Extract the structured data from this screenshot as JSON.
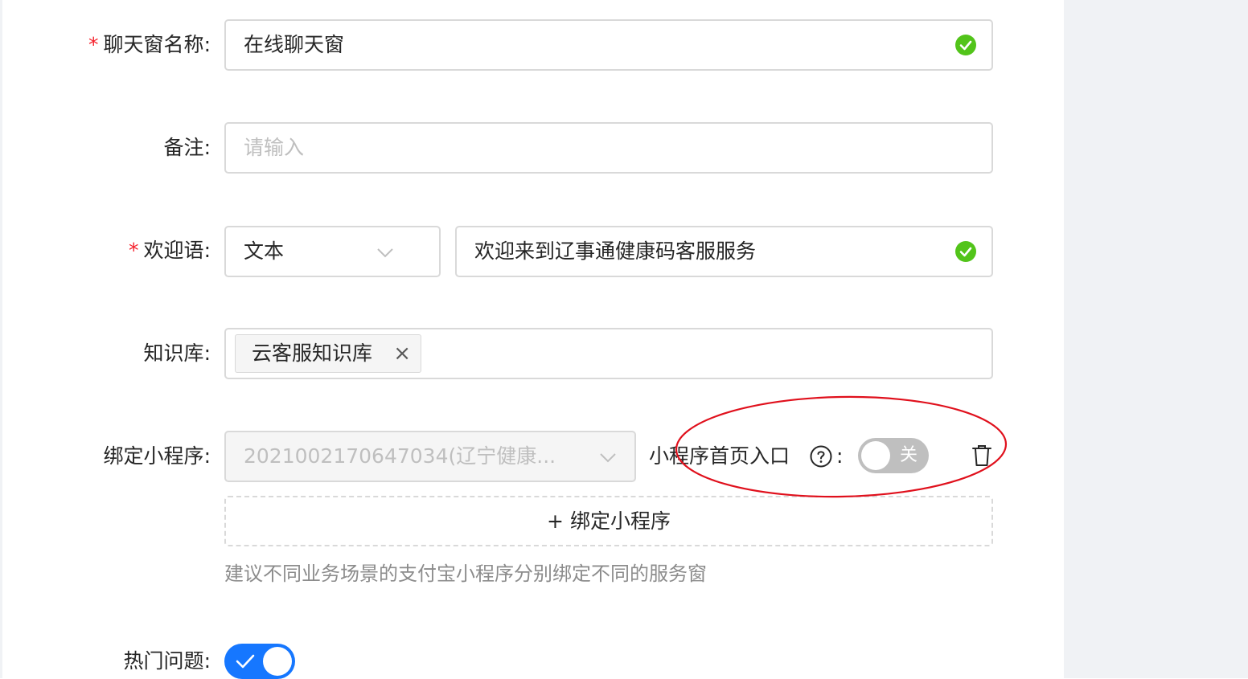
{
  "form": {
    "chat_name": {
      "label": "聊天窗名称",
      "required_mark": "*",
      "value": "在线聊天窗"
    },
    "remark": {
      "label": "备注",
      "placeholder": "请输入"
    },
    "welcome": {
      "label": "欢迎语",
      "required_mark": "*",
      "type_value": "文本",
      "text_value": "欢迎来到辽事通健康码客服服务"
    },
    "knowledge": {
      "label": "知识库",
      "tag": "云客服知识库",
      "tag_close": "×"
    },
    "miniprogram": {
      "label": "绑定小程序",
      "select_value": "2021002170647034(辽宁健康...",
      "entry_label": "小程序首页入口",
      "entry_toggle_text": "关",
      "entry_toggle_on": false,
      "bind_button": "+ 绑定小程序",
      "hint": "建议不同业务场景的支付宝小程序分别绑定不同的服务窗"
    },
    "hot_questions": {
      "label": "热门问题",
      "toggle_on": true
    }
  },
  "colon": ":",
  "icons": {
    "valid": "check-circle-icon",
    "dropdown": "chevron-down-icon",
    "help": "question-circle-icon",
    "delete": "trash-icon",
    "toggle_check": "check-icon"
  },
  "colors": {
    "primary": "#1677ff",
    "success": "#52c41a",
    "required": "#f5222d",
    "annotation": "#e0101c"
  }
}
